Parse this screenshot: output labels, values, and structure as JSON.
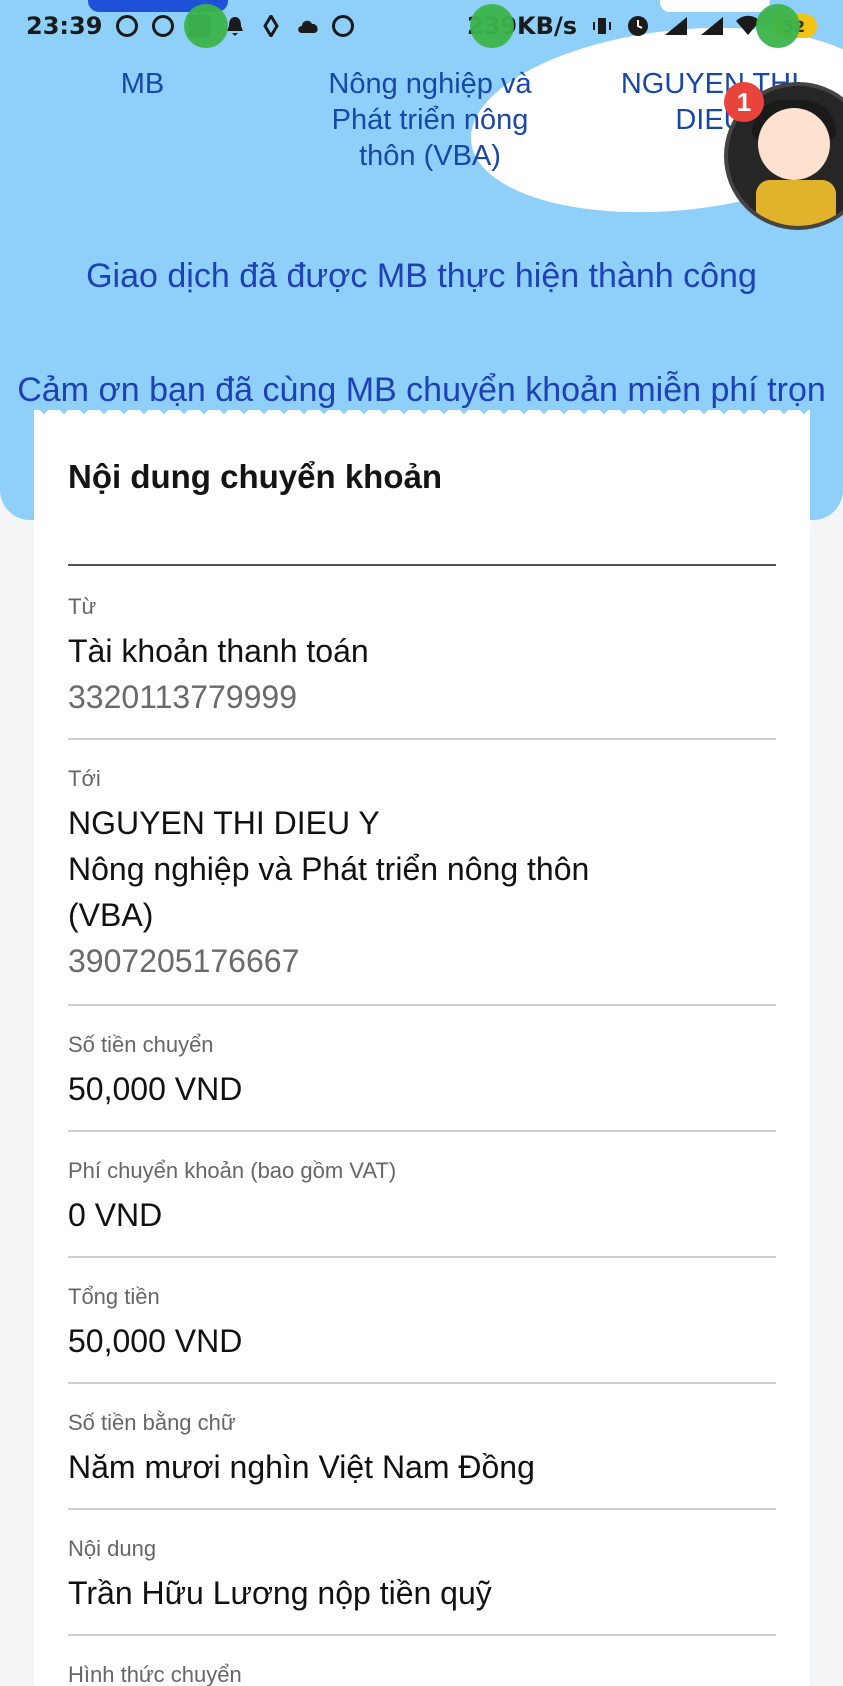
{
  "status_bar": {
    "time": "23:39",
    "speed": "239KB/s",
    "battery": "32"
  },
  "header": {
    "from_bank": "MB",
    "to_bank": "Nông nghiệp và Phát triển nông thôn (VBA)",
    "recipient": "NGUYEN THI DIEU",
    "notification_count": "1",
    "success_message": "Giao dịch đã được MB thực hiện thành công",
    "thanks_message": "Cảm ơn bạn đã cùng MB chuyển khoản miễn phí trọn đời!"
  },
  "card": {
    "title": "Nội dung chuyển khoản",
    "from": {
      "label": "Từ",
      "account_type": "Tài khoản thanh toán",
      "account_number": "3320113779999"
    },
    "to": {
      "label": "Tới",
      "name": "NGUYEN THI DIEU Y",
      "bank_line1": "Nông nghiệp và Phát triển nông thôn",
      "bank_line2": "(VBA)",
      "account_number": "3907205176667"
    },
    "amount": {
      "label": "Số tiền chuyển",
      "value": "50,000 VND"
    },
    "fee": {
      "label": "Phí chuyển khoản (bao gồm VAT)",
      "value": "0 VND"
    },
    "total": {
      "label": "Tổng tiền",
      "value": "50,000 VND"
    },
    "amount_words": {
      "label": "Số tiền bằng chữ",
      "value": "Năm mươi nghìn Việt Nam Đồng"
    },
    "content": {
      "label": "Nội dung",
      "value": "Trần Hữu Lương nộp tiền quỹ"
    },
    "method": {
      "label": "Hình thức chuyển"
    }
  }
}
